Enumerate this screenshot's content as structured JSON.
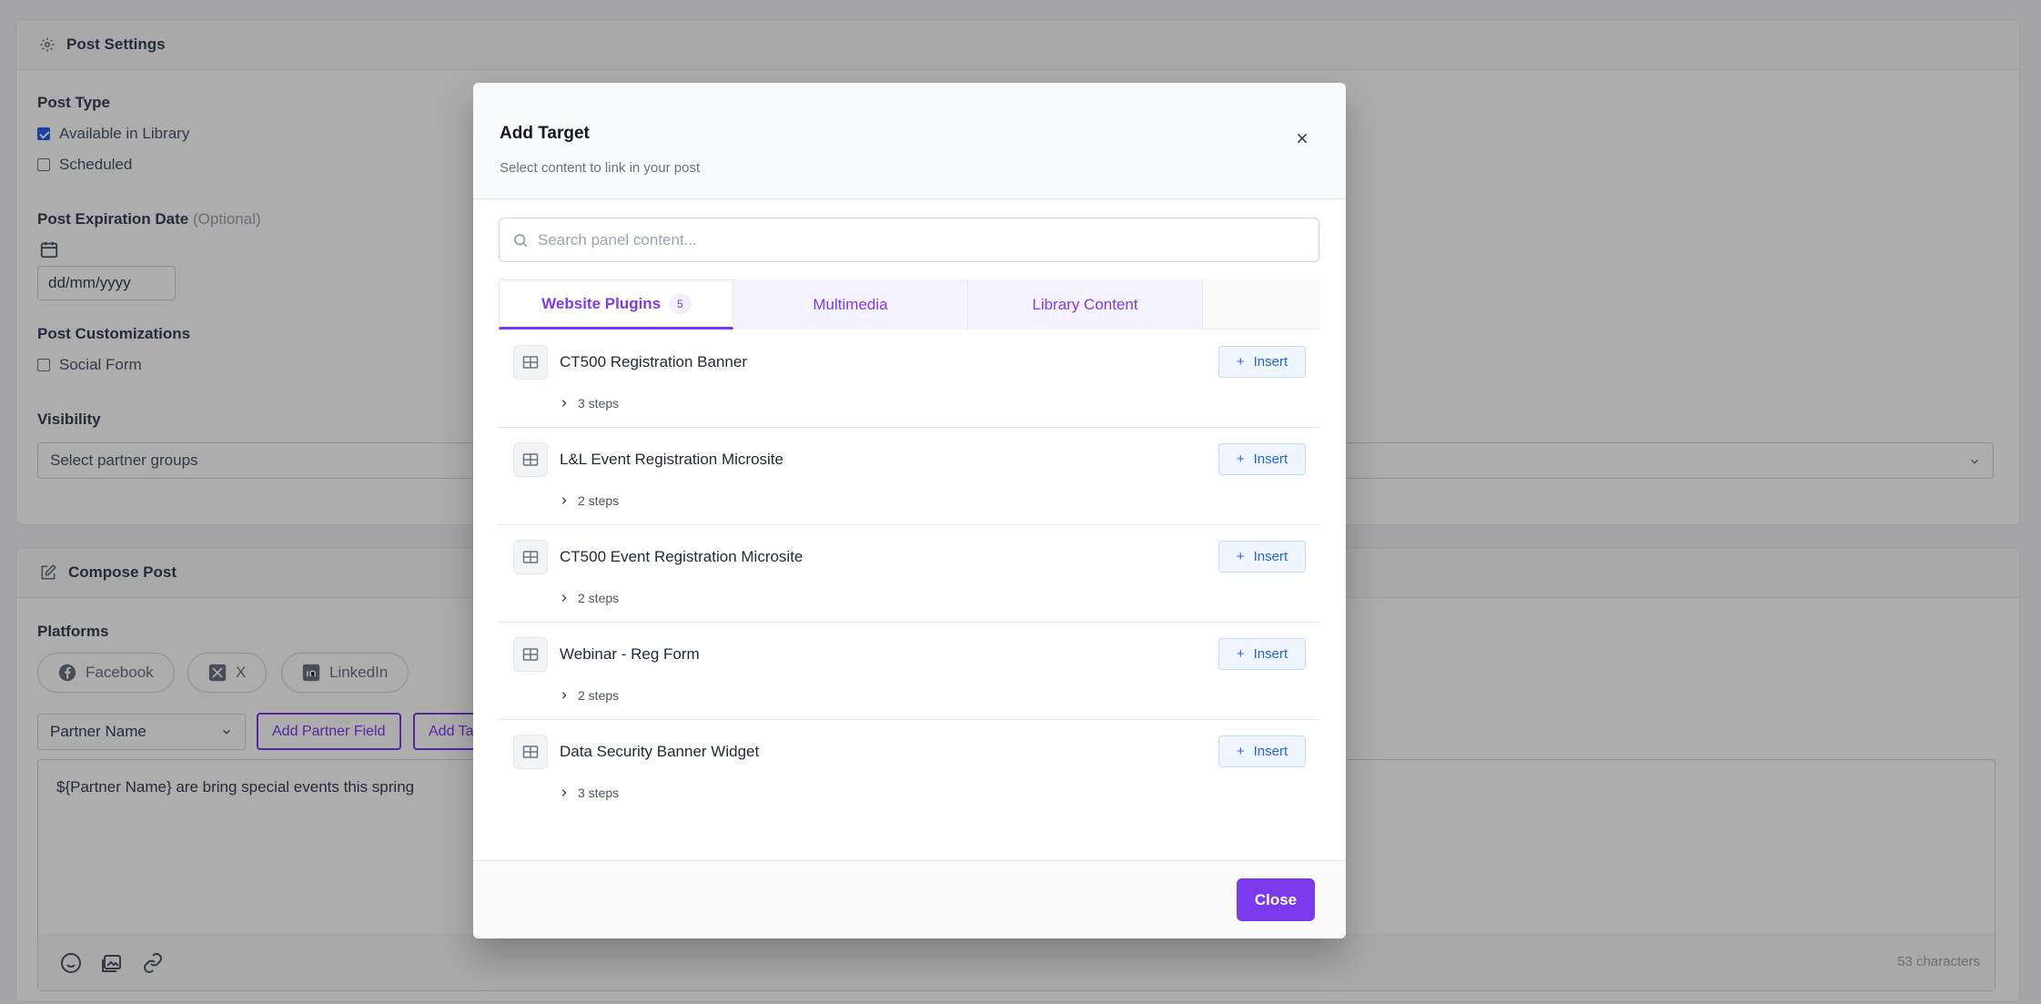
{
  "settings": {
    "header": "Post Settings",
    "post_type_label": "Post Type",
    "available_in_library": "Available in Library",
    "scheduled": "Scheduled",
    "expiration_label": "Post Expiration Date",
    "expiration_optional": "(Optional)",
    "date_placeholder": "dd/mm/yyyy",
    "customizations_label": "Post Customizations",
    "social_form": "Social Form",
    "visibility_label": "Visibility",
    "visibility_placeholder": "Select partner groups"
  },
  "compose": {
    "header": "Compose Post",
    "platforms_label": "Platforms",
    "platforms": [
      "Facebook",
      "X",
      "LinkedIn"
    ],
    "partner_select": "Partner Name",
    "add_partner_field": "Add Partner Field",
    "add_target_partial": "Add Ta",
    "text": "${Partner Name} are bring special events this spring",
    "char_count": "53 characters"
  },
  "modal": {
    "title": "Add Target",
    "subtitle": "Select content to link in your post",
    "search_placeholder": "Search panel content...",
    "tabs": [
      {
        "label": "Website Plugins",
        "badge": "5"
      },
      {
        "label": "Multimedia"
      },
      {
        "label": "Library Content"
      }
    ],
    "items": [
      {
        "title": "CT500 Registration Banner",
        "steps": "3 steps"
      },
      {
        "title": "L&L Event Registration Microsite",
        "steps": "2 steps"
      },
      {
        "title": "CT500 Event Registration Microsite",
        "steps": "2 steps"
      },
      {
        "title": "Webinar - Reg Form",
        "steps": "2 steps"
      },
      {
        "title": "Data Security Banner Widget",
        "steps": "3 steps"
      }
    ],
    "insert_label": "Insert",
    "close_label": "Close"
  },
  "colors": {
    "accent": "#7c3aed",
    "insert": "#2563eb"
  }
}
